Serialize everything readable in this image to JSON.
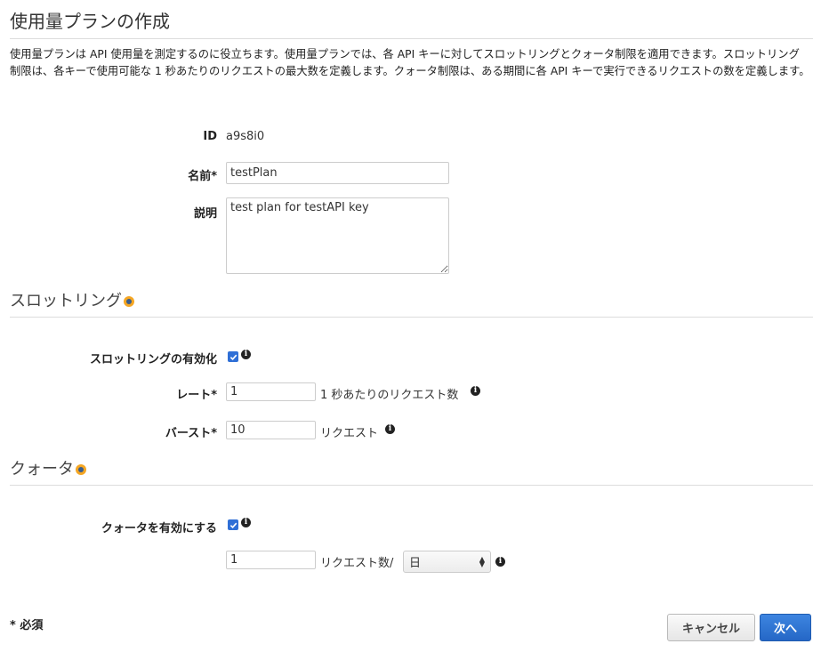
{
  "page": {
    "title": "使用量プランの作成",
    "description": "使用量プランは API 使用量を測定するのに役立ちます。使用量プランでは、各 API キーに対してスロットリングとクォータ制限を適用できます。スロットリング制限は、各キーで使用可能な 1 秒あたりのリクエストの最大数を定義します。クォータ制限は、ある期間に各 API キーで実行できるリクエストの数を定義します。"
  },
  "form": {
    "id_label": "ID",
    "id_value": "a9s8i0",
    "name_label": "名前*",
    "name_value": "testPlan",
    "description_label": "説明",
    "description_value": "test plan for testAPI key"
  },
  "throttling": {
    "section_title": "スロットリング",
    "enable_label": "スロットリングの有効化",
    "enabled": true,
    "rate_label": "レート*",
    "rate_value": "1",
    "rate_unit": "1 秒あたりのリクエスト数",
    "burst_label": "バースト*",
    "burst_value": "10",
    "burst_unit": "リクエスト"
  },
  "quota": {
    "section_title": "クォータ",
    "enable_label": "クォータを有効にする",
    "enabled": true,
    "value": "1",
    "unit": "リクエスト数/",
    "period_selected": "日"
  },
  "footer": {
    "required_note": "* 必須",
    "cancel_label": "キャンセル",
    "next_label": "次へ"
  },
  "icons": {
    "info": "info-icon",
    "section_help": "help-dot-icon",
    "checkbox": "check-icon"
  },
  "colors": {
    "primary_button": "#2567c6",
    "checkbox": "#2f6fd6",
    "help_dot": "#f5a623"
  }
}
